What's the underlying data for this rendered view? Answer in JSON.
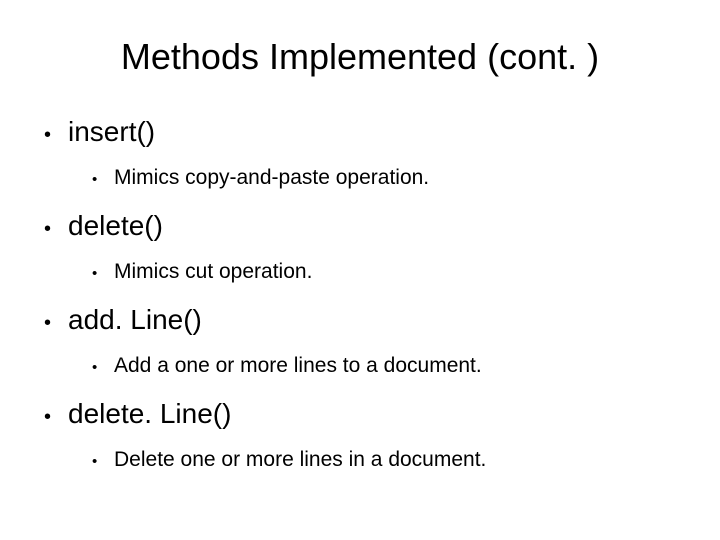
{
  "title": "Methods Implemented (cont. )",
  "items": [
    {
      "label": "insert()",
      "desc": "Mimics copy-and-paste operation."
    },
    {
      "label": "delete()",
      "desc": "Mimics cut operation."
    },
    {
      "label": "add. Line()",
      "desc": "Add a one or more lines to a document."
    },
    {
      "label": "delete. Line()",
      "desc": "Delete one or more lines in a document."
    }
  ]
}
